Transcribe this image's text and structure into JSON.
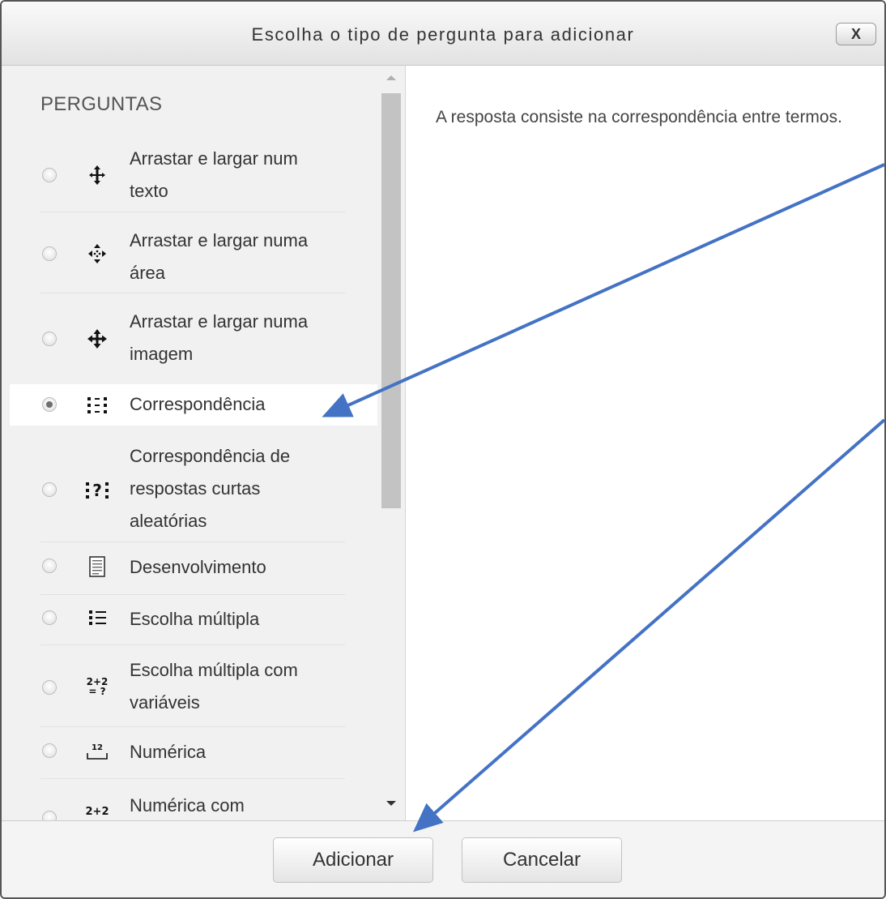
{
  "dialog": {
    "title": "Escolha o tipo de pergunta para adicionar",
    "close_label": "X"
  },
  "sidebar": {
    "section_title": "PERGUNTAS",
    "items": [
      {
        "line1": "Arrastar e largar num",
        "line2": "texto",
        "line3": "",
        "icon": "move-text-icon",
        "selected": false
      },
      {
        "line1": "Arrastar e largar numa",
        "line2": "área",
        "line3": "",
        "icon": "move-area-icon",
        "selected": false
      },
      {
        "line1": "Arrastar e largar numa",
        "line2": "imagem",
        "line3": "",
        "icon": "move-image-icon",
        "selected": false
      },
      {
        "line1": "Correspondência",
        "line2": "",
        "line3": "",
        "icon": "match-icon",
        "selected": true
      },
      {
        "line1": "Correspondência de",
        "line2": "respostas curtas",
        "line3": "aleatórias",
        "icon": "random-short-answer-match-icon",
        "selected": false
      },
      {
        "line1": "Desenvolvimento",
        "line2": "",
        "line3": "",
        "icon": "essay-icon",
        "selected": false
      },
      {
        "line1": "Escolha múltipla",
        "line2": "",
        "line3": "",
        "icon": "multiple-choice-icon",
        "selected": false
      },
      {
        "line1": "Escolha múltipla com",
        "line2": "variáveis",
        "line3": "",
        "icon": "calculated-multichoice-icon",
        "selected": false
      },
      {
        "line1": "Numérica",
        "line2": "",
        "line3": "",
        "icon": "numerical-icon",
        "selected": false
      },
      {
        "line1": "Numérica com",
        "line2": "",
        "line3": "",
        "icon": "calculated-icon",
        "selected": false
      }
    ]
  },
  "icons": {
    "formula_top": "2+2",
    "formula_bottom": "= ?",
    "numeric_value": "12",
    "random_symbol": "?"
  },
  "description": "A resposta consiste na correspondência entre termos.",
  "footer": {
    "add_label": "Adicionar",
    "cancel_label": "Cancelar"
  },
  "annotations": {
    "arrow_color": "#4472C4"
  },
  "colors": {
    "dialog_border": "#555555",
    "pane_background": "#f1f1f1",
    "selected_background": "#ffffff"
  }
}
